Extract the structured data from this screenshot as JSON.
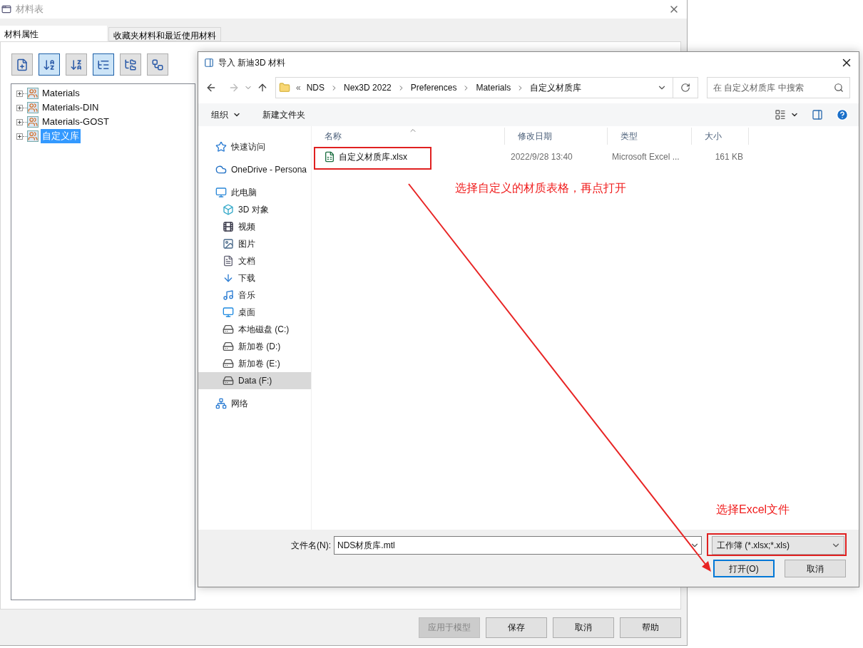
{
  "main_window": {
    "title": "材料表",
    "tabs": [
      {
        "label": "材料属性",
        "selected": true
      },
      {
        "label": "收藏夹材料和最近使用材料",
        "selected": false
      }
    ],
    "toolbar": [
      {
        "kind": "new",
        "selected": false
      },
      {
        "kind": "sort-asc",
        "selected": true
      },
      {
        "kind": "sort-desc",
        "selected": false
      },
      {
        "kind": "tree",
        "selected": true
      },
      {
        "kind": "folders",
        "selected": false
      },
      {
        "kind": "list",
        "selected": false
      }
    ],
    "tree": [
      {
        "label": "Materials",
        "selected": false
      },
      {
        "label": "Materials-DIN",
        "selected": false
      },
      {
        "label": "Materials-GOST",
        "selected": false
      },
      {
        "label": "自定义库",
        "selected": true
      }
    ],
    "buttons": [
      {
        "label": "应用于模型",
        "disabled": true
      },
      {
        "label": "保存",
        "disabled": false
      },
      {
        "label": "取消",
        "disabled": false
      },
      {
        "label": "帮助",
        "disabled": false
      }
    ]
  },
  "dialog": {
    "title": "导入 新迪3D 材料",
    "overflow_mark": "«",
    "breadcrumb": [
      "NDS",
      "Nex3D 2022",
      "Preferences",
      "Materials",
      "自定义材质库"
    ],
    "search": {
      "placeholder": "在 自定义材质库 中搜索"
    },
    "commands": [
      "组织",
      "新建文件夹"
    ],
    "nav": [
      {
        "label": "快速访问",
        "kind": "star",
        "selected": false
      },
      {
        "label": "OneDrive - Persona",
        "kind": "cloud",
        "selected": false
      },
      {
        "label": "此电脑",
        "kind": "pc",
        "selected": false,
        "children": [
          {
            "label": "3D 对象",
            "kind": "cube",
            "selected": false
          },
          {
            "label": "视频",
            "kind": "film",
            "selected": false
          },
          {
            "label": "图片",
            "kind": "image",
            "selected": false
          },
          {
            "label": "文档",
            "kind": "doc",
            "selected": false
          },
          {
            "label": "下载",
            "kind": "download",
            "selected": false
          },
          {
            "label": "音乐",
            "kind": "music",
            "selected": false
          },
          {
            "label": "桌面",
            "kind": "desktop",
            "selected": false
          },
          {
            "label": "本地磁盘 (C:)",
            "kind": "system-drive",
            "selected": false
          },
          {
            "label": "新加卷 (D:)",
            "kind": "drive",
            "selected": false
          },
          {
            "label": "新加卷 (E:)",
            "kind": "drive",
            "selected": false
          },
          {
            "label": "Data (F:)",
            "kind": "drive",
            "selected": true
          }
        ]
      },
      {
        "label": "网络",
        "kind": "network",
        "selected": false
      }
    ],
    "columns": [
      "名称",
      "修改日期",
      "类型",
      "大小"
    ],
    "files": [
      {
        "name": "自定义材质库.xlsx",
        "modified": "2022/9/28 13:40",
        "type": "Microsoft Excel ...",
        "size": "161 KB"
      }
    ],
    "filename": {
      "label": "文件名(N):",
      "value": "NDS材质库.mtl"
    },
    "filetype": "工作簿 (*.xlsx;*.xls)",
    "buttons": [
      {
        "label": "打开(O)",
        "default": true
      },
      {
        "label": "取消",
        "default": false
      }
    ]
  },
  "annotations": [
    {
      "text": "选择自定义的材质表格，再点打开"
    },
    {
      "text": "选择Excel文件"
    }
  ]
}
